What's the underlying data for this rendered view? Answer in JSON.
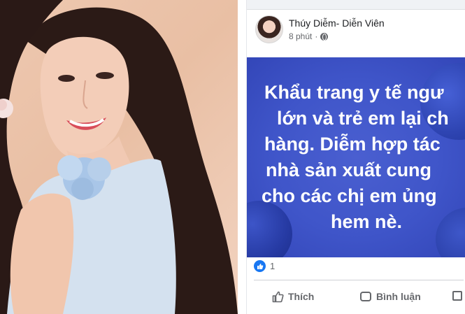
{
  "post": {
    "author": "Thúy Diễm- Diễn Viên",
    "time": "8 phút",
    "text_lines": [
      "Khẩu trang y tế ngư",
      "lớn và trẻ em lại ch",
      "hàng. Diễm hợp tác",
      "nhà sản xuất cung",
      "cho các chị em ủng",
      "hem nè."
    ],
    "reaction_count": "1",
    "like_label": "Thích",
    "comment_label": "Bình luận",
    "background_color": "#4054c8",
    "text_color": "#ffffff",
    "accent_color": "#1877f2"
  },
  "icons": {
    "privacy": "globe-icon",
    "like": "thumbs-up-icon",
    "comment": "comment-bubble-icon",
    "share": "share-icon",
    "reaction": "like-reaction-icon"
  }
}
